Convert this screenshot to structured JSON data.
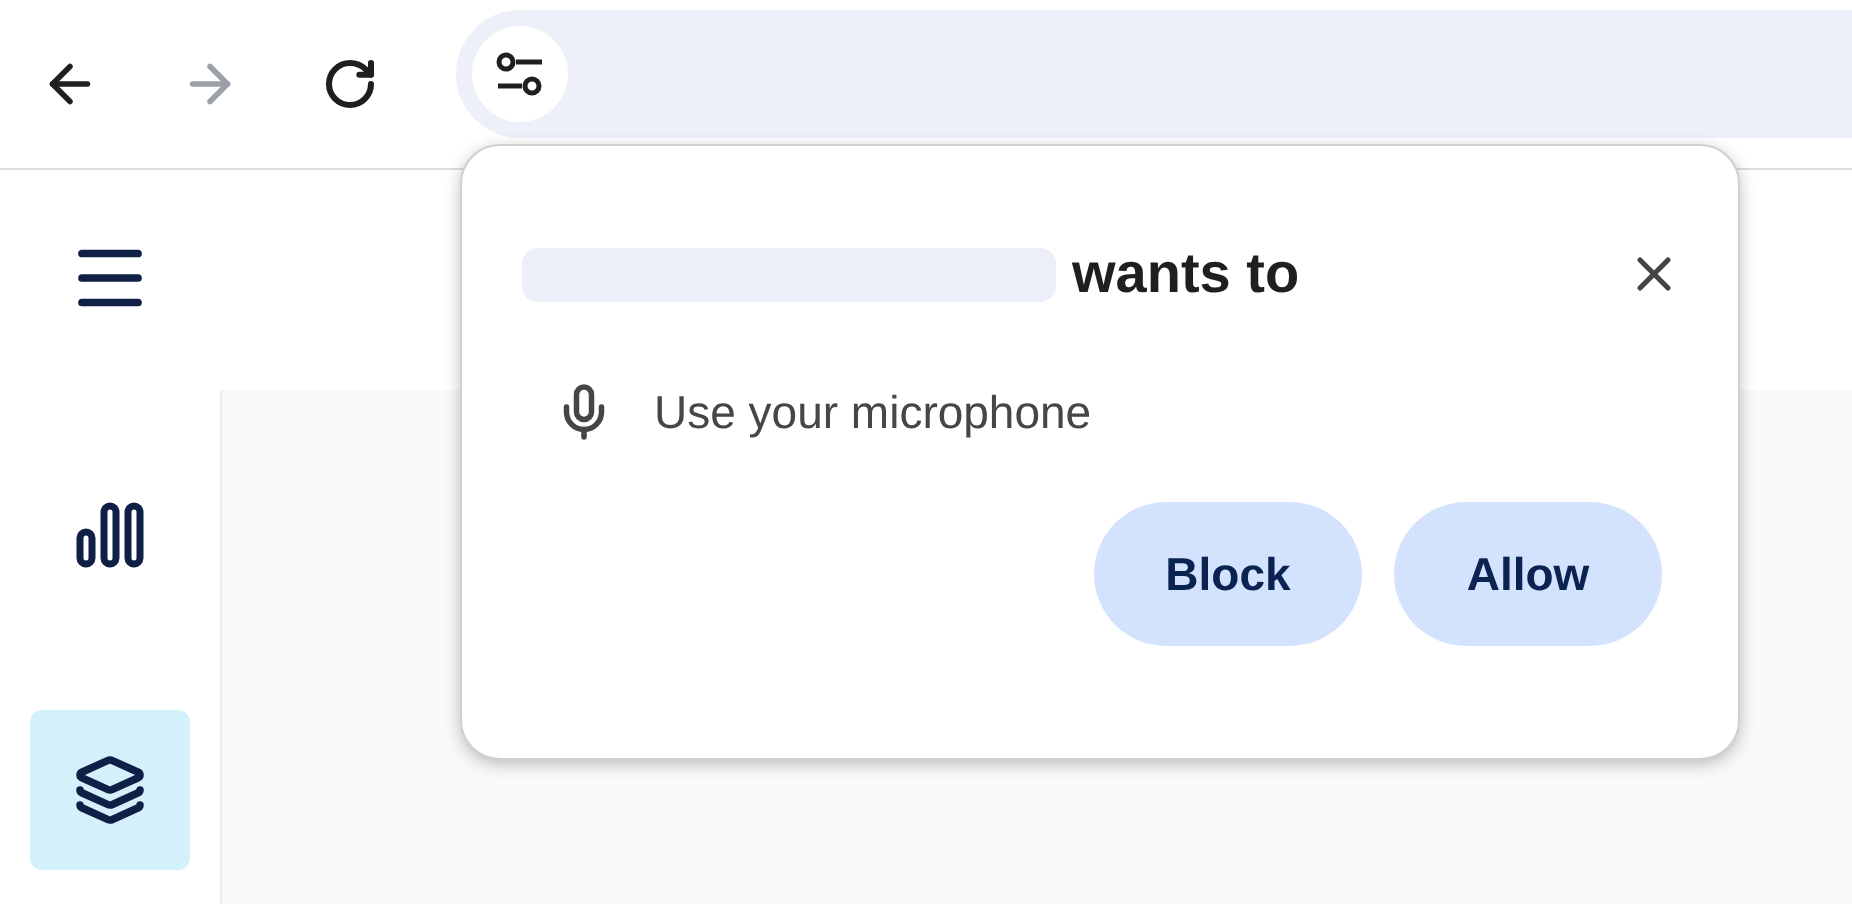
{
  "toolbar": {
    "back_enabled": true,
    "forward_enabled": false
  },
  "sidebar": {
    "items": [
      {
        "kind": "menu",
        "selected": false
      },
      {
        "kind": "chart",
        "selected": false
      },
      {
        "kind": "layers",
        "selected": true
      }
    ]
  },
  "prompt": {
    "title": "wants to",
    "permission": "Use your microphone",
    "buttons": [
      "Block",
      "Allow"
    ]
  }
}
